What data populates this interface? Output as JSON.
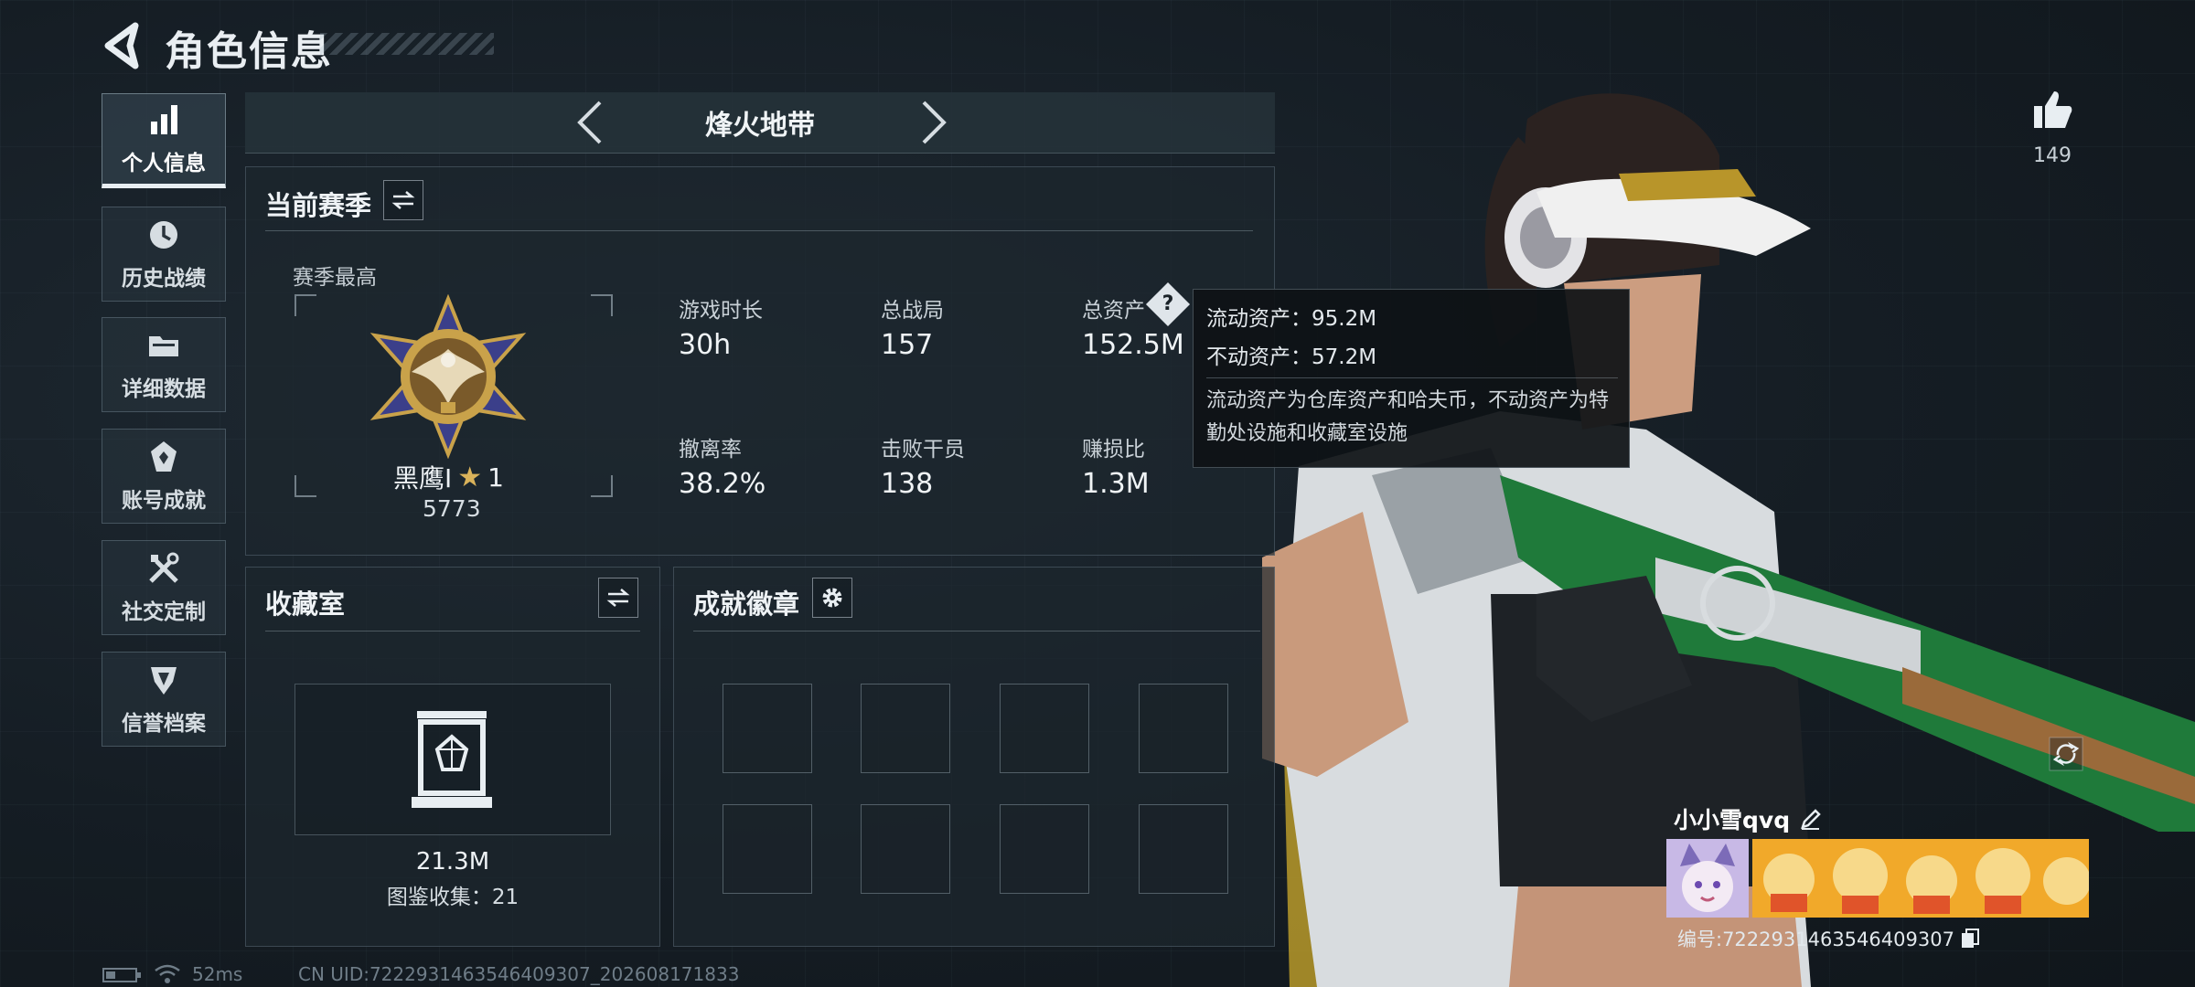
{
  "header": {
    "title": "角色信息"
  },
  "sidebar": {
    "items": [
      {
        "label": "个人信息",
        "icon": "bar-chart-icon",
        "active": true
      },
      {
        "label": "历史战绩",
        "icon": "clock-history-icon",
        "active": false
      },
      {
        "label": "详细数据",
        "icon": "folder-icon",
        "active": false
      },
      {
        "label": "账号成就",
        "icon": "achievement-icon",
        "active": false
      },
      {
        "label": "社交定制",
        "icon": "tools-icon",
        "active": false
      },
      {
        "label": "信誉档案",
        "icon": "credit-shield-icon",
        "active": false
      }
    ]
  },
  "mode": {
    "title": "烽火地带"
  },
  "season": {
    "title": "当前赛季",
    "best_label": "赛季最高",
    "rank_name": "黑鹰I",
    "rank_stars": "1",
    "rank_score": "5773",
    "stats": [
      {
        "label": "游戏时长",
        "value": "30h"
      },
      {
        "label": "总战局",
        "value": "157"
      },
      {
        "label": "总资产",
        "value": "152.5M"
      },
      {
        "label": "撤离率",
        "value": "38.2%"
      },
      {
        "label": "击败干员",
        "value": "138"
      },
      {
        "label": "赚损比",
        "value": "1.3M"
      }
    ]
  },
  "tooltip": {
    "liquid": "流动资产：95.2M",
    "fixed": "不动资产：57.2M",
    "desc": "流动资产为仓库资产和哈夫币，不动资产为特勤处设施和收藏室设施"
  },
  "collection": {
    "title": "收藏室",
    "value": "21.3M",
    "count": "图鉴收集：21"
  },
  "achievements": {
    "title": "成就徽章"
  },
  "likes": {
    "count": "149"
  },
  "player": {
    "name": "小小雪qvq",
    "id_text": "编号:7222931463546409307"
  },
  "status": {
    "ping": "52ms",
    "uid": "CN UID:7222931463546409307_202608171833"
  },
  "colors": {
    "accent": "#e8eef2",
    "panel": "#1c262e",
    "gun_green": "#1f7a3a"
  }
}
